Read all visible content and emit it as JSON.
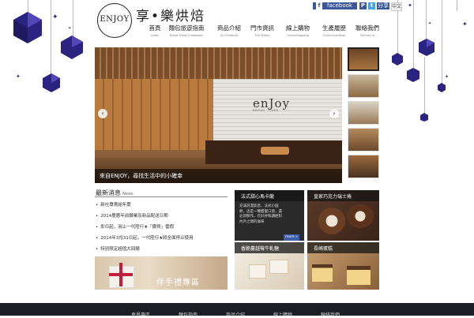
{
  "header": {
    "logo_text": "ENJOY",
    "brand": "享•樂烘焙",
    "facebook_label": "facebook",
    "share_label": "分享",
    "lang_label": "中文",
    "icon_f": "f",
    "icon_plurk": "P",
    "icon_twitter": "t"
  },
  "nav": {
    "items": [
      {
        "zh": "首頁",
        "en": "Index"
      },
      {
        "zh": "麵包旅遊指南",
        "en": "Bread Travel Guidebook"
      },
      {
        "zh": "商品介紹",
        "en": "Our Products"
      },
      {
        "zh": "門市資訊",
        "en": "Our Stores"
      },
      {
        "zh": "線上購物",
        "en": "OnlineShopping"
      },
      {
        "zh": "生產履歷",
        "en": "CurriculumVitae"
      },
      {
        "zh": "聯絡我們",
        "en": "Contact us"
      }
    ]
  },
  "hero": {
    "sign_text": "enJoy",
    "sign_sub": "BREAD · CAKE",
    "caption": "來自ENJOY，尋找生活中的小確幸",
    "prev_icon": "chevron-left-icon",
    "next_icon": "chevron-right-icon"
  },
  "news": {
    "title": "最新消息",
    "title_en": "News",
    "items": [
      "新社專賣組年慶",
      "2014農曆年前鑽業及新品配送日期",
      "即日起，淑止一代陸行★「鑽貨」雷假",
      "2014年3月31日起，一代陸行★將全面停止使用",
      "特別限定超值大回饋"
    ]
  },
  "gift": {
    "label": "伴手禮專區"
  },
  "tiles": [
    {
      "title": "法式甜心馬卡龍",
      "desc": "充滿浪漫氣息，法式小圓餅，這是一種甜蜜口感，還必須製作，在好評和讀經對內外之間的滋味",
      "more": "more »"
    },
    {
      "title": "皇家巧克力瑞士捲",
      "desc": "",
      "more": ""
    },
    {
      "title": "香脆蔓越莓牛軋糖",
      "desc": "",
      "more": ""
    },
    {
      "title": "長崎蛋糕",
      "desc": "",
      "more": ""
    }
  ],
  "footer": {
    "items": [
      "會員專區",
      "麵包指南",
      "商品介紹",
      "線上購物",
      "聯絡我們"
    ]
  },
  "colors": {
    "gem": "#2e2a7a",
    "facebook": "#3b5998",
    "footer_bg": "#1d1d28"
  }
}
